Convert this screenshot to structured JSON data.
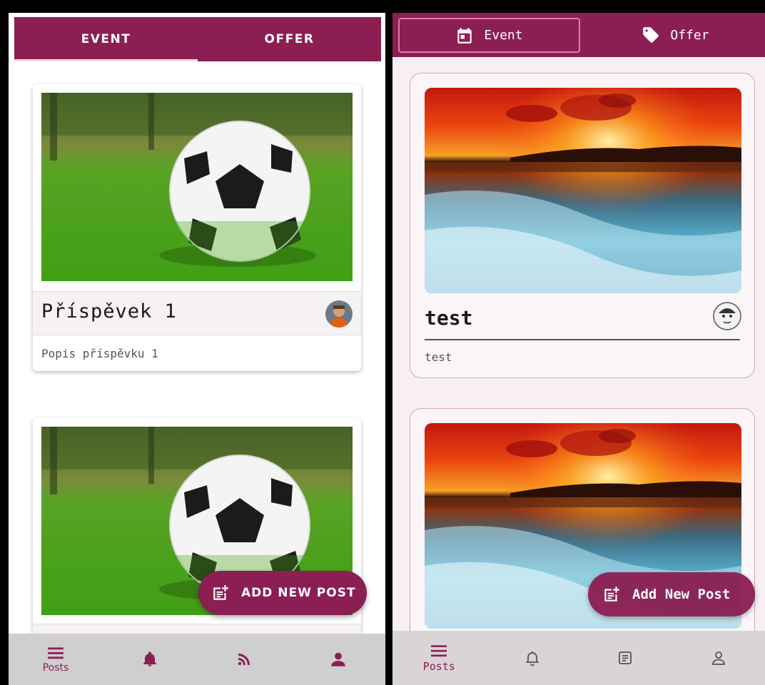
{
  "left": {
    "tabs": [
      {
        "label": "EVENT",
        "active": true
      },
      {
        "label": "OFFER",
        "active": false
      }
    ],
    "posts": [
      {
        "title": "Příspěvek 1",
        "description": "Popis příspěvku 1",
        "image": "soccer-ball-on-grass",
        "avatar": "user-avatar-photo"
      },
      {
        "title": "",
        "description": "",
        "image": "soccer-ball-on-grass",
        "avatar": "user-avatar-photo"
      }
    ],
    "fab": {
      "label": "ADD NEW POST",
      "icon": "post-add-icon"
    },
    "nav": [
      {
        "label": "Posts",
        "icon": "menu-icon",
        "active": true
      },
      {
        "label": "",
        "icon": "bell-icon",
        "active": false
      },
      {
        "label": "",
        "icon": "rss-feed-icon",
        "active": false
      },
      {
        "label": "",
        "icon": "person-icon",
        "active": false
      }
    ],
    "colors": {
      "primary": "#8b1e52",
      "nav_bg": "#cfcfcf"
    }
  },
  "right": {
    "tabs": [
      {
        "label": "Event",
        "icon": "calendar-icon",
        "active": true
      },
      {
        "label": "Offer",
        "icon": "tag-icon",
        "active": false
      }
    ],
    "posts": [
      {
        "title": "test",
        "description": "test",
        "image": "sunset-ocean-waves",
        "avatar": "sketch-avatar"
      },
      {
        "title": "",
        "description": "",
        "image": "sunset-ocean-waves",
        "avatar": ""
      }
    ],
    "fab": {
      "label": "Add New Post",
      "icon": "post-add-icon"
    },
    "nav": [
      {
        "label": "Posts",
        "icon": "menu-icon",
        "active": true
      },
      {
        "label": "",
        "icon": "bell-outline-icon",
        "active": false
      },
      {
        "label": "",
        "icon": "article-outline-icon",
        "active": false
      },
      {
        "label": "",
        "icon": "person-outline-icon",
        "active": false
      }
    ],
    "colors": {
      "primary": "#8b1e52",
      "background": "#f7eff2",
      "card_border": "#d4a6bb"
    }
  }
}
